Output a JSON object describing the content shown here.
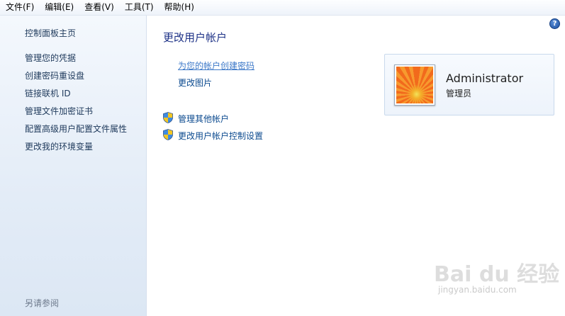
{
  "menu": [
    {
      "label": "文件(F)"
    },
    {
      "label": "编辑(E)"
    },
    {
      "label": "查看(V)"
    },
    {
      "label": "工具(T)"
    },
    {
      "label": "帮助(H)"
    }
  ],
  "sidebar": {
    "home": "控制面板主页",
    "links": [
      "管理您的凭据",
      "创建密码重设盘",
      "链接联机 ID",
      "管理文件加密证书",
      "配置高级用户配置文件属性",
      "更改我的环境变量"
    ],
    "see_also": "另请参阅"
  },
  "main": {
    "title": "更改用户帐户",
    "tasks": [
      "为您的帐户创建密码",
      "更改图片"
    ],
    "shield_tasks": [
      "管理其他帐户",
      "更改用户帐户控制设置"
    ],
    "help_icon": "?"
  },
  "account": {
    "name": "Administrator",
    "role": "管理员",
    "avatar": "orange-flower-picture"
  },
  "watermark": {
    "text": "Bai du 经验",
    "url": "jingyan.baidu.com"
  },
  "colors": {
    "link": "#0b4a8f",
    "title": "#1e3287",
    "sidebar_bg": "#e3ecf7"
  }
}
